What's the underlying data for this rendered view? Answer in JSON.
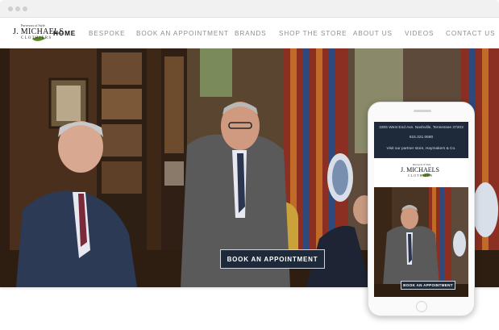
{
  "logo": {
    "tagline": "Purveyors of Style",
    "name": "J. MICHAELS",
    "sub": "CLOTHIERS"
  },
  "nav": {
    "items": [
      {
        "label": "HOME",
        "active": true
      },
      {
        "label": "BESPOKE",
        "active": false
      },
      {
        "label": "BOOK AN APPOINTMENT",
        "active": false
      },
      {
        "label": "BRANDS",
        "active": false
      },
      {
        "label": "SHOP THE STORE",
        "active": false
      },
      {
        "label": "ABOUT US",
        "active": false
      },
      {
        "label": "VIDEOS",
        "active": false
      },
      {
        "label": "CONTACT US",
        "active": false
      }
    ]
  },
  "hero": {
    "cta_label": "BOOK AN APPOINTMENT"
  },
  "phone": {
    "address": "3305 West End Ave. Nashville, Tennessee 37203",
    "phone": "615.321.0680",
    "partner": "Visit our partner store, Haymakers & Co.",
    "cta_label": "BOOK AN APPOINTMENT"
  },
  "colors": {
    "navy": "#1e2a3a",
    "nav_gray": "#8f8f8f",
    "leaf_green": "#5c8a2a"
  }
}
